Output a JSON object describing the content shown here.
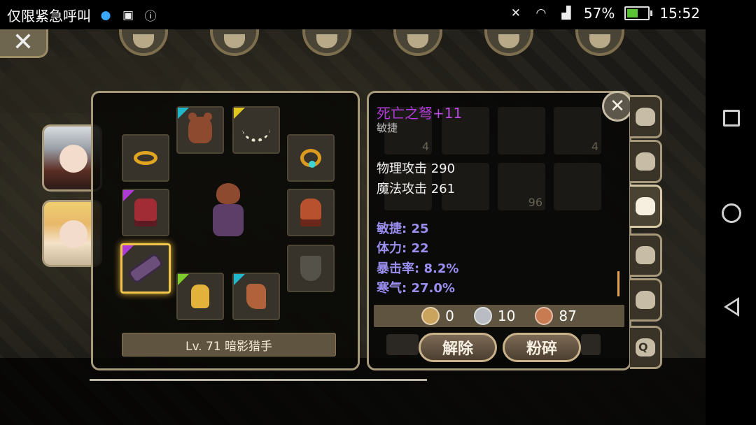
{
  "status_bar": {
    "app_name": "仅限紧急呼叫",
    "battery": "57%",
    "battery_level": 0.57,
    "time": "15:52"
  },
  "top_nav": {
    "icons": [
      "close-icon",
      "head-icon",
      "bag-icon",
      "compass-icon",
      "robe-icon",
      "scroll-icon",
      "gear-icon"
    ]
  },
  "equipment": {
    "slots": [
      {
        "icon": "gold-ring-icon"
      },
      {
        "icon": "bear-helmet-icon",
        "rarity_color": "#1fb7c9"
      },
      {
        "icon": "bone-necklace-icon",
        "rarity_color": "#e1c71f"
      },
      {
        "icon": "gem-ring-icon"
      },
      {
        "icon": "red-armor-icon",
        "rarity_color": "#b03ad6"
      },
      {
        "icon": "red-cloak-icon"
      },
      {
        "icon": "crossbow-icon",
        "rarity_color": "#b03ad6",
        "selected": true
      },
      {
        "icon": "empty-shield-icon"
      },
      {
        "icon": "gold-glove-icon",
        "rarity_color": "#7ccd2b"
      },
      {
        "icon": "leather-boot-icon",
        "rarity_color": "#1fb7c9"
      }
    ],
    "level_label": "Lv. 71 暗影猎手"
  },
  "detail": {
    "title": "死亡之弩",
    "title_plus": "+11",
    "partial_line": "敏捷",
    "physical_attack": "物理攻击 290",
    "magic_attack": "魔法攻击 261",
    "agility": "敏捷: 25",
    "stamina": "体力: 22",
    "crit_rate": "暴击率: 8.2%",
    "chill": "寒气: 27.0%",
    "ghost_slot_counts": [
      "4",
      "4",
      "96"
    ]
  },
  "currency": {
    "gold": "0",
    "silver": "10",
    "copper": "87",
    "colors": {
      "gold": "#caa35c",
      "silver": "#b9bcc2",
      "copper": "#c87a50"
    }
  },
  "actions": {
    "unequip": "解除",
    "shatter": "粉碎"
  },
  "side_tabs": {
    "icons": [
      "bag-icon",
      "bag-icon",
      "bag-icon",
      "bag-icon",
      "bag-icon",
      "quest-bag-icon"
    ],
    "quest_letter": "Q",
    "active_index": 2
  }
}
